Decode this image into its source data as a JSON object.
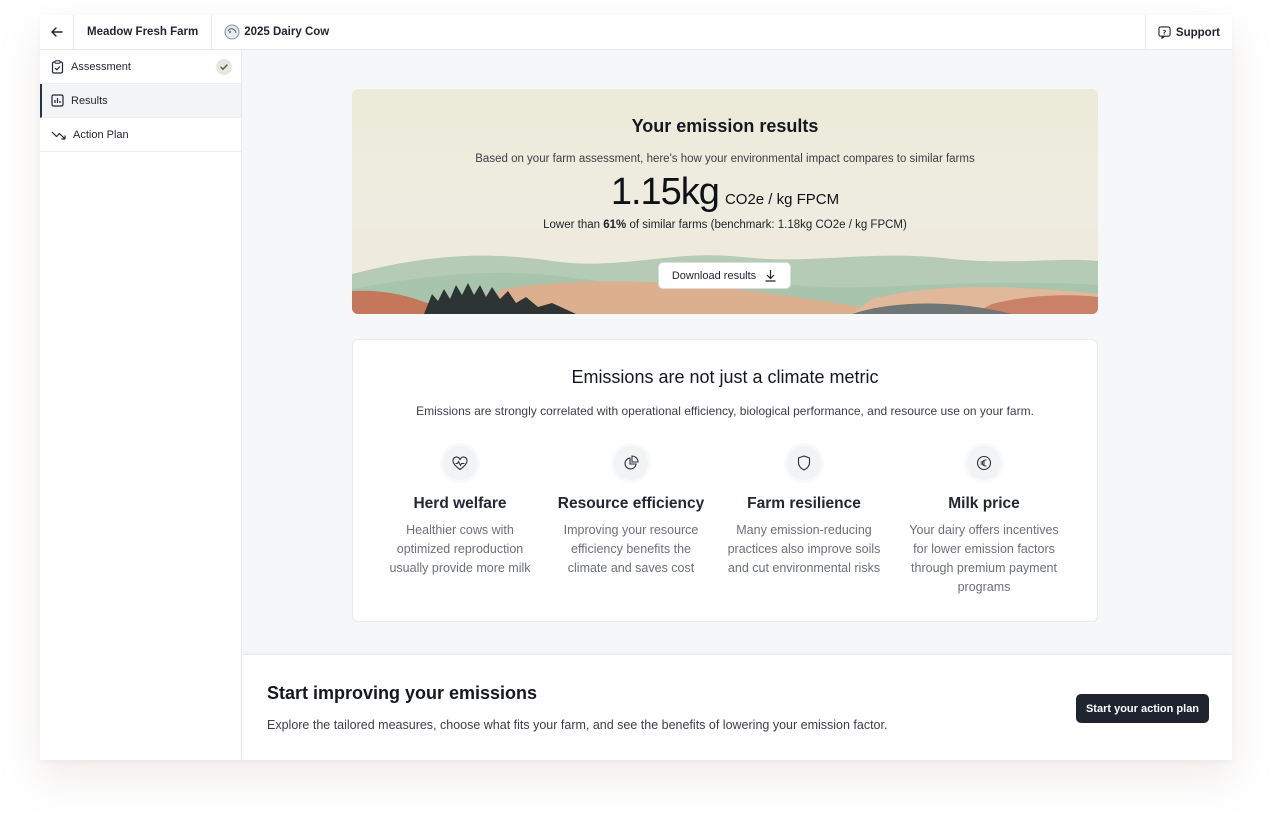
{
  "topbar": {
    "farm_name": "Meadow Fresh Farm",
    "project_name": "2025 Dairy Cow",
    "support_label": "Support"
  },
  "sidebar": {
    "items": [
      {
        "label": "Assessment",
        "icon": "clipboard-check-icon",
        "completed": true
      },
      {
        "label": "Results",
        "icon": "bar-chart-icon",
        "active": true
      },
      {
        "label": "Action Plan",
        "icon": "trend-down-icon"
      }
    ]
  },
  "hero": {
    "title": "Your emission results",
    "subtitle": "Based on your farm assessment, here's how your environmental impact compares to similar farms",
    "value": "1.15kg",
    "unit": "CO2e / kg FPCM",
    "compare_prefix": "Lower than ",
    "compare_percent": "61%",
    "compare_suffix": " of similar farms (benchmark: 1.18kg CO2e / kg FPCM)",
    "download_label": "Download results"
  },
  "correlation": {
    "title": "Emissions are not just a climate metric",
    "subtitle": "Emissions are strongly correlated with operational efficiency, biological performance, and resource use on your farm.",
    "features": [
      {
        "icon": "heart-pulse-icon",
        "title": "Herd welfare",
        "desc": "Healthier cows with optimized reproduction usually provide more milk"
      },
      {
        "icon": "pie-chart-icon",
        "title": "Resource efficiency",
        "desc": "Improving your resource efficiency benefits the climate and saves cost"
      },
      {
        "icon": "shield-icon",
        "title": "Farm resilience",
        "desc": "Many emission-reducing practices also improve soils and cut environmental risks"
      },
      {
        "icon": "euro-icon",
        "title": "Milk price",
        "desc": "Your dairy offers incentives for lower emission factors through premium payment programs"
      }
    ]
  },
  "cta": {
    "title": "Start improving your emissions",
    "subtitle": "Explore the tailored measures, choose what fits your farm, and see the benefits of lowering your emission factor.",
    "button_label": "Start your action plan"
  },
  "colors": {
    "primary_dark": "#1f2430",
    "hill_green": "#a8c4ad",
    "hill_sand": "#dcb08f",
    "hill_terracotta": "#c4775a"
  }
}
